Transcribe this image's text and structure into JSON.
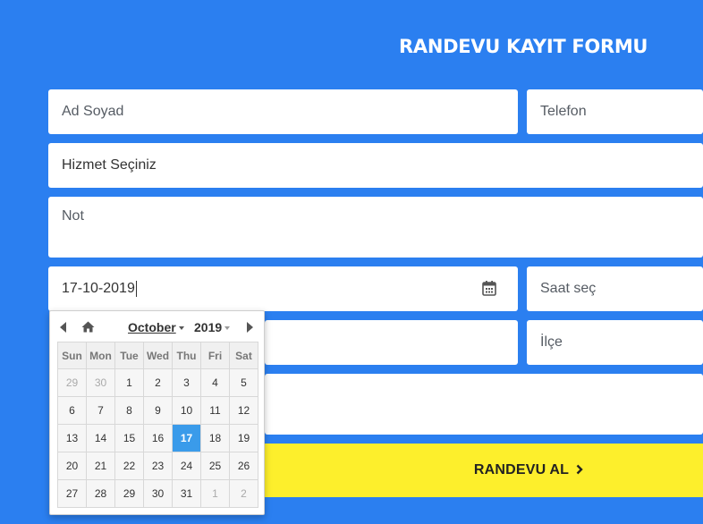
{
  "form": {
    "title": "RANDEVU KAYIT FORMU",
    "name_placeholder": "Ad Soyad",
    "phone_placeholder": "Telefon",
    "service_placeholder": "Hizmet Seçiniz",
    "note_placeholder": "Not",
    "date_value": "17-10-2019",
    "time_placeholder": "Saat seç",
    "district_placeholder": "İlçe",
    "submit_label": "RANDEVU AL",
    "submit_icon": "chevron-right-icon"
  },
  "datepicker": {
    "month": "October",
    "year": "2019",
    "weekdays": [
      "Sun",
      "Mon",
      "Tue",
      "Wed",
      "Thu",
      "Fri",
      "Sat"
    ],
    "weeks": [
      [
        {
          "d": "29",
          "other": true
        },
        {
          "d": "30",
          "other": true
        },
        {
          "d": "1"
        },
        {
          "d": "2"
        },
        {
          "d": "3"
        },
        {
          "d": "4"
        },
        {
          "d": "5"
        }
      ],
      [
        {
          "d": "6"
        },
        {
          "d": "7"
        },
        {
          "d": "8"
        },
        {
          "d": "9"
        },
        {
          "d": "10"
        },
        {
          "d": "11"
        },
        {
          "d": "12"
        }
      ],
      [
        {
          "d": "13"
        },
        {
          "d": "14"
        },
        {
          "d": "15"
        },
        {
          "d": "16"
        },
        {
          "d": "17",
          "selected": true
        },
        {
          "d": "18"
        },
        {
          "d": "19"
        }
      ],
      [
        {
          "d": "20"
        },
        {
          "d": "21"
        },
        {
          "d": "22"
        },
        {
          "d": "23"
        },
        {
          "d": "24"
        },
        {
          "d": "25"
        },
        {
          "d": "26"
        }
      ],
      [
        {
          "d": "27"
        },
        {
          "d": "28"
        },
        {
          "d": "29"
        },
        {
          "d": "30"
        },
        {
          "d": "31"
        },
        {
          "d": "1",
          "other": true
        },
        {
          "d": "2",
          "other": true
        }
      ]
    ],
    "selected_color": "#3a9bea"
  },
  "colors": {
    "background": "#2b7ff0",
    "submit": "#fdef2c"
  }
}
